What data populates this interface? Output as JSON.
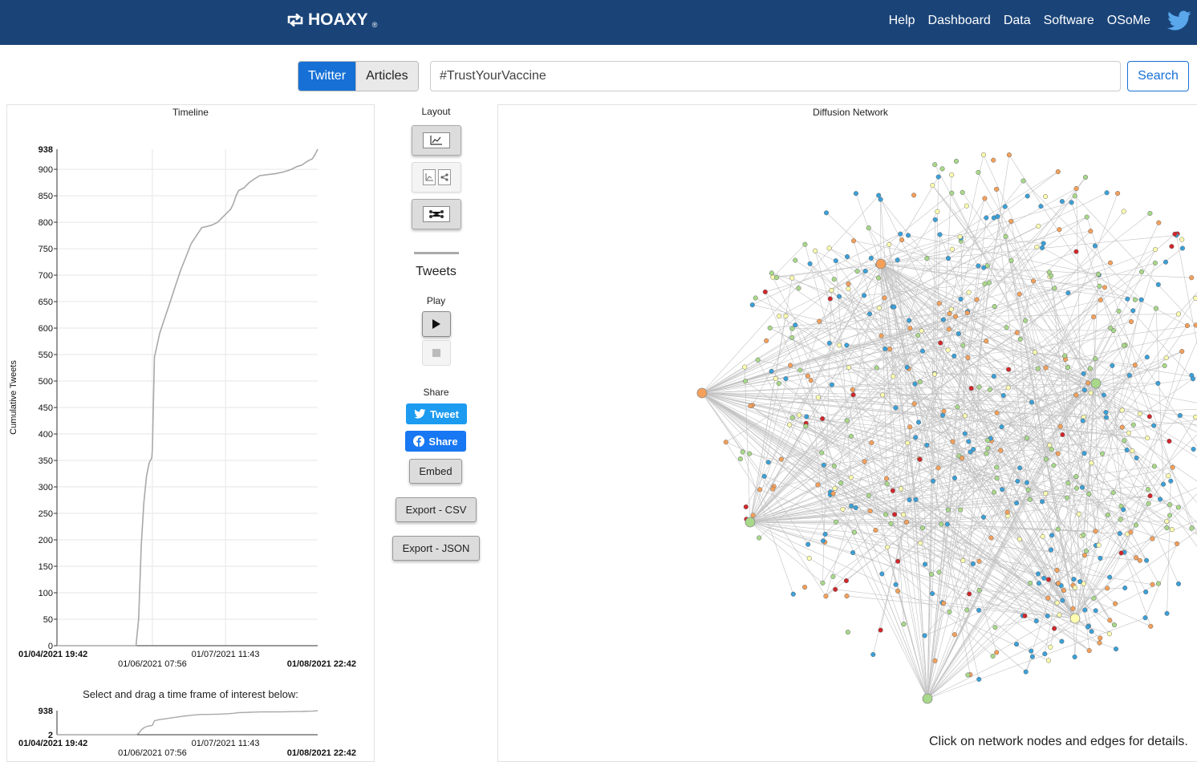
{
  "nav": {
    "brand": "HOAXY",
    "brand_mark": "®",
    "links": [
      "Help",
      "Dashboard",
      "Data",
      "Software",
      "OSoMe"
    ],
    "twitter_icon": "twitter-bird-icon",
    "background": "#1a4478"
  },
  "search": {
    "sources": [
      {
        "label": "Twitter",
        "active": true
      },
      {
        "label": "Articles",
        "active": false
      }
    ],
    "query": "#TrustYourVaccine",
    "button": "Search",
    "accent": "#1670d6"
  },
  "timeline": {
    "title": "Timeline",
    "brush_instruction": "Select and drag a time frame of interest below:"
  },
  "controls": {
    "layout_label": "Layout",
    "layout_buttons": [
      "chart-icon",
      "chart-and-network-icon",
      "network-icon"
    ],
    "tweets_label": "Tweets",
    "play_label": "Play",
    "share_label": "Share",
    "tweet_button": "Tweet",
    "facebook_button": "Share",
    "embed_button": "Embed",
    "export_csv": "Export - CSV",
    "export_json": "Export - JSON"
  },
  "network": {
    "title": "Diffusion Network",
    "footer": "Click on network nodes and edges for details.",
    "node_colors": [
      "#3aa0d8",
      "#f5a05a",
      "#a8d88a",
      "#ffffb0",
      "#d0262a"
    ]
  },
  "chart_data": [
    {
      "type": "line",
      "title": "",
      "xlabel": "",
      "ylabel": "Cumulative Tweets",
      "ylim": [
        0,
        938
      ],
      "yticks": [
        0,
        50,
        100,
        150,
        200,
        250,
        300,
        350,
        400,
        450,
        500,
        550,
        600,
        650,
        700,
        750,
        800,
        850,
        900
      ],
      "ymax_label": "938",
      "x_tick_labels": [
        "01/04/2021 19:42",
        "01/06/2021 07:56",
        "01/07/2021 11:43",
        "01/08/2021 22:42"
      ],
      "x_tick_hours": [
        0,
        36.23,
        64,
        99
      ],
      "grid": true,
      "series": [
        {
          "x": [
            0,
            30,
            31,
            32,
            33,
            34,
            35,
            36,
            36.23,
            37,
            39,
            41,
            43,
            45,
            47,
            49,
            51,
            53,
            55,
            57,
            59,
            61,
            62,
            64,
            65,
            66,
            67,
            68,
            69,
            71,
            73,
            75,
            77,
            80,
            83,
            86,
            88,
            89,
            91,
            93,
            95,
            97,
            98,
            99
          ],
          "y": [
            0,
            0,
            50,
            190,
            270,
            320,
            345,
            355,
            370,
            545,
            590,
            620,
            650,
            680,
            710,
            735,
            760,
            775,
            790,
            792,
            795,
            800,
            805,
            815,
            820,
            825,
            835,
            850,
            860,
            865,
            875,
            882,
            888,
            890,
            892,
            895,
            898,
            900,
            905,
            908,
            915,
            920,
            928,
            938
          ]
        }
      ]
    },
    {
      "type": "area",
      "title": "",
      "ylim": [
        2,
        938
      ],
      "ytick_labels": [
        "938",
        "2"
      ],
      "x_tick_labels": [
        "01/04/2021 19:42",
        "01/06/2021 07:56",
        "01/07/2021 11:43",
        "01/08/2021 22:42"
      ],
      "series": [
        {
          "x": [
            0,
            30,
            31,
            32,
            33,
            34,
            35,
            36,
            36.23,
            37,
            39,
            41,
            43,
            45,
            47,
            49,
            51,
            53,
            55,
            57,
            59,
            61,
            62,
            64,
            65,
            66,
            67,
            68,
            69,
            71,
            73,
            75,
            77,
            80,
            83,
            86,
            88,
            89,
            91,
            93,
            95,
            97,
            98,
            99
          ],
          "y": [
            0,
            0,
            50,
            190,
            270,
            320,
            345,
            355,
            370,
            545,
            590,
            620,
            650,
            680,
            710,
            735,
            760,
            775,
            790,
            792,
            795,
            800,
            805,
            815,
            820,
            825,
            835,
            850,
            860,
            865,
            875,
            882,
            888,
            890,
            892,
            895,
            898,
            900,
            905,
            908,
            915,
            920,
            928,
            938
          ]
        }
      ]
    }
  ]
}
